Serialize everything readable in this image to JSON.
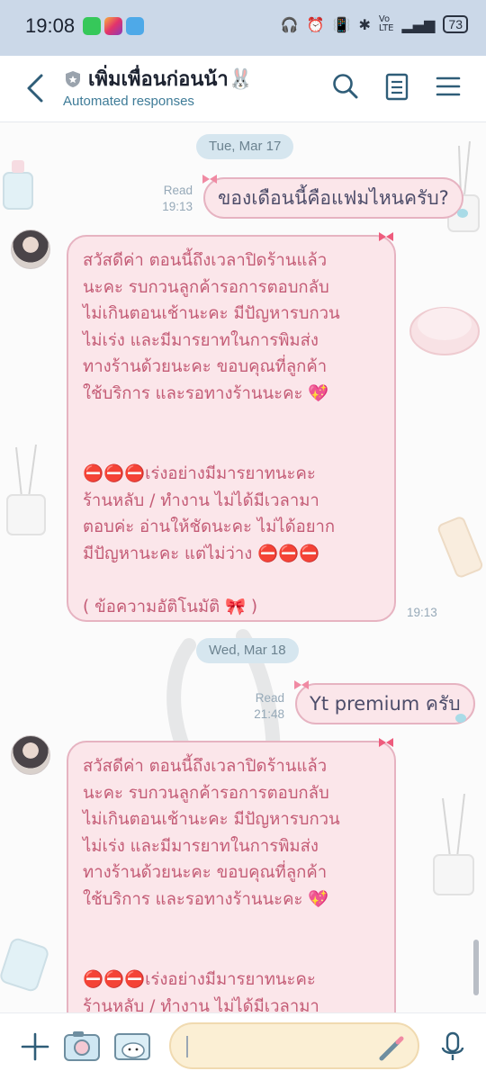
{
  "status_bar": {
    "time": "19:08",
    "battery": "73"
  },
  "header": {
    "title": "เพิ่มเพื่อนก่อนน้า🐰",
    "subtitle": "Automated responses"
  },
  "messages": [
    {
      "type": "date",
      "text": "Tue, Mar 17"
    },
    {
      "type": "outgoing",
      "read_label": "Read",
      "time": "19:13",
      "text": "ของเดือนนี้คือแฟมไหนครับ?"
    },
    {
      "type": "incoming",
      "time": "19:13",
      "para1": "สวัสดีค่า ตอนนี้ถึงเวลาปิดร้านแล้ว\nนะคะ รบกวนลูกค้ารอการตอบกลับ\nไม่เกินตอนเช้านะคะ มีปัญหารบกวน\nไม่เร่ง และมีมารยาทในการพิมส่ง\nทางร้านด้วยนะคะ ขอบคุณที่ลูกค้า\nใช้บริการ และรอทางร้านนะคะ 💖",
      "para2": "⛔⛔⛔เร่งอย่างมีมารยาทนะคะ\nร้านหลับ / ทำงาน ไม่ได้มีเวลามา\nตอบค่ะ อ่านให้ชัดนะคะ ไม่ได้อยาก\nมีปัญหานะคะ แต่ไม่ว่าง ⛔⛔⛔",
      "para3": "( ข้อความอัติโนมัติ 🎀 )"
    },
    {
      "type": "date",
      "text": "Wed, Mar 18"
    },
    {
      "type": "outgoing",
      "read_label": "Read",
      "time": "21:48",
      "text": "Yt premium ครับ"
    },
    {
      "type": "incoming",
      "para1": "สวัสดีค่า ตอนนี้ถึงเวลาปิดร้านแล้ว\nนะคะ รบกวนลูกค้ารอการตอบกลับ\nไม่เกินตอนเช้านะคะ มีปัญหารบกวน\nไม่เร่ง และมีมารยาทในการพิมส่ง\nทางร้านด้วยนะคะ ขอบคุณที่ลูกค้า\nใช้บริการ และรอทางร้านนะคะ 💖",
      "para2": "⛔⛔⛔เร่งอย่างมีมารยาทนะคะ\nร้านหลับ / ทำงาน ไม่ได้มีเวลามา"
    }
  ],
  "input": {
    "value": "",
    "placeholder": ""
  },
  "colors": {
    "bubble_fill": "#fbe6ea",
    "bubble_border": "#e6b3c1",
    "incoming_text": "#c45c76",
    "date_pill": "#d6e6ef",
    "input_fill": "#fbefd4"
  },
  "icons": [
    "back-icon",
    "shield-icon",
    "search-icon",
    "notes-icon",
    "menu-icon",
    "plus-icon",
    "camera-icon",
    "gallery-icon",
    "pen-icon",
    "mic-icon"
  ]
}
